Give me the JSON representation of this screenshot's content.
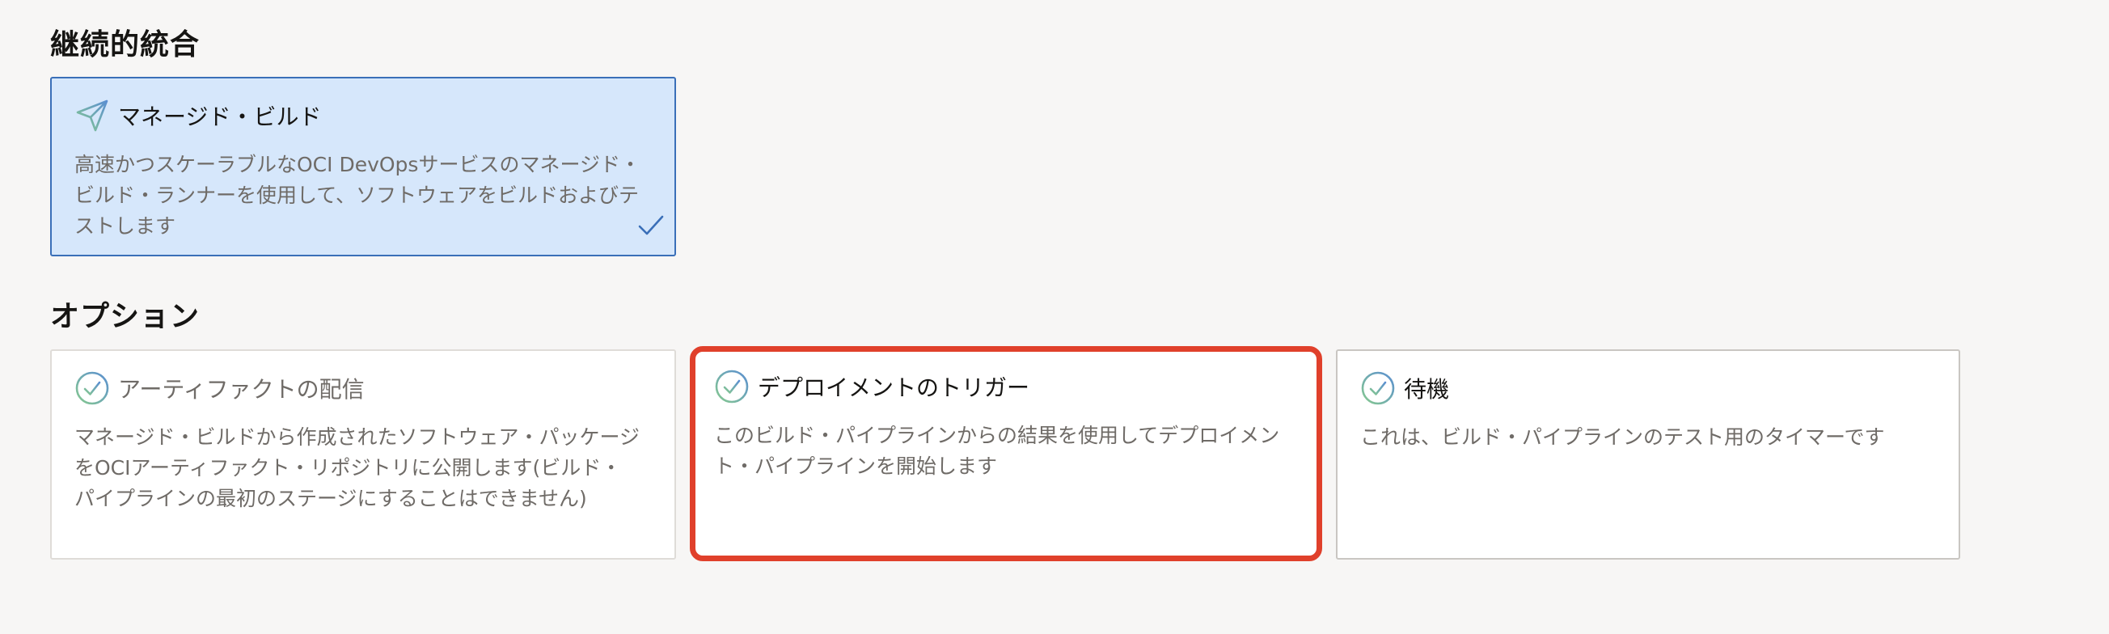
{
  "sections": {
    "continuous_integration": {
      "title": "継続的統合",
      "cards": [
        {
          "title": "マネージド・ビルド",
          "description": "高速かつスケーラブルなOCI DevOpsサービスのマネージド・ビルド・ランナーを使用して、ソフトウェアをビルドおよびテストします",
          "icon": "paper-plane-icon",
          "selected": true
        }
      ]
    },
    "options": {
      "title": "オプション",
      "cards": [
        {
          "title": "アーティファクトの配信",
          "description": "マネージド・ビルドから作成されたソフトウェア・パッケージをOCIアーティファクト・リポジトリに公開します(ビルド・パイプラインの最初のステージにすることはできません)",
          "icon": "check-circle-icon",
          "disabled": true
        },
        {
          "title": "デプロイメントのトリガー",
          "description": "このビルド・パイプラインからの結果を使用してデプロイメント・パイプラインを開始します",
          "icon": "check-circle-icon",
          "highlighted": true
        },
        {
          "title": "待機",
          "description": "これは、ビルド・パイプラインのテスト用のタイマーです",
          "icon": "check-circle-icon"
        }
      ]
    }
  },
  "colors": {
    "background": "#f7f6f5",
    "selected_card": "#d6e7fb",
    "selected_border": "#3a6fb8",
    "highlight_border": "#e0402b",
    "icon_green": "#7cc48c",
    "icon_blue": "#5b8fd1"
  }
}
